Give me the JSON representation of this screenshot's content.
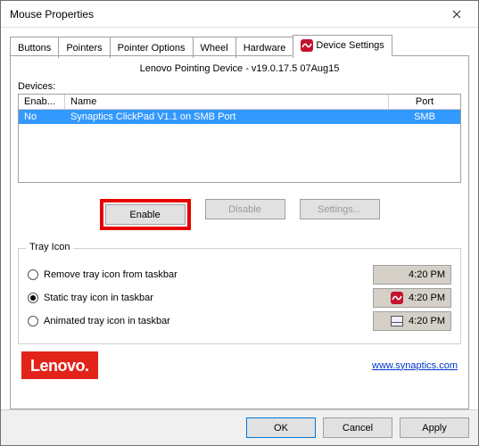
{
  "window": {
    "title": "Mouse Properties"
  },
  "tabs": {
    "items": [
      {
        "label": "Buttons"
      },
      {
        "label": "Pointers"
      },
      {
        "label": "Pointer Options"
      },
      {
        "label": "Wheel"
      },
      {
        "label": "Hardware"
      },
      {
        "label": "Device Settings"
      }
    ]
  },
  "panel": {
    "device_title": "Lenovo Pointing Device - v19.0.17.5 07Aug15",
    "devices_label": "Devices:",
    "columns": {
      "enabled": "Enab...",
      "name": "Name",
      "port": "Port"
    },
    "rows": [
      {
        "enabled": "No",
        "name": "Synaptics ClickPad V1.1 on SMB Port",
        "port": "SMB"
      }
    ],
    "buttons": {
      "enable": "Enable",
      "disable": "Disable",
      "settings": "Settings..."
    }
  },
  "tray": {
    "group_title": "Tray Icon",
    "time": "4:20 PM",
    "options": [
      {
        "label": "Remove tray icon from taskbar",
        "checked": false,
        "icon": "none"
      },
      {
        "label": "Static tray icon in taskbar",
        "checked": true,
        "icon": "synaptics"
      },
      {
        "label": "Animated tray icon in taskbar",
        "checked": false,
        "icon": "touchpad"
      }
    ]
  },
  "footer": {
    "logo_text": "Lenovo.",
    "link_text": "www.synaptics.com"
  },
  "dialog_buttons": {
    "ok": "OK",
    "cancel": "Cancel",
    "apply": "Apply"
  },
  "colors": {
    "brand": "#e2231a",
    "selection": "#3399ff",
    "link": "#0033cc"
  }
}
